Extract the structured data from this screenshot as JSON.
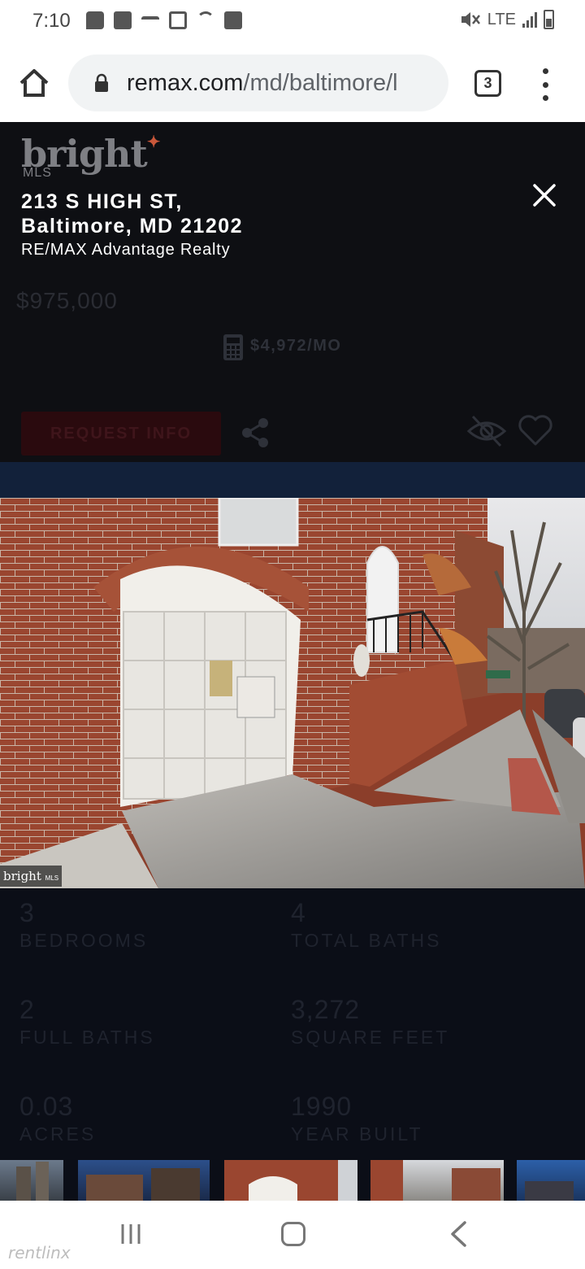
{
  "status_bar": {
    "time": "7:10",
    "network": "LTE",
    "icons": [
      "message-icon",
      "square-icon",
      "missed-call-icon",
      "image-icon",
      "wifi-icon",
      "app-icon",
      "mute-icon",
      "signal-icon",
      "battery-icon"
    ]
  },
  "browser": {
    "url_host": "remax.com",
    "url_path": "/md/baltimore/l",
    "tab_count": "3"
  },
  "listing": {
    "brand": "bright",
    "brand_sub": "MLS",
    "address_line1": "213 S HIGH ST,",
    "address_line2": "Baltimore, MD 21202",
    "agency": "RE/MAX Advantage Realty",
    "price": "$975,000",
    "monthly": "$4,972/MO",
    "request_info_label": "REQUEST INFO",
    "photo_watermark": "bright",
    "photo_watermark_sub": "MLS"
  },
  "facts": [
    {
      "value": "3",
      "label": "BEDROOMS"
    },
    {
      "value": "4",
      "label": "TOTAL BATHS"
    },
    {
      "value": "2",
      "label": "FULL BATHS"
    },
    {
      "value": "3,272",
      "label": "SQUARE FEET"
    },
    {
      "value": "0.03",
      "label": "ACRES"
    },
    {
      "value": "1990",
      "label": "YEAR BUILT"
    }
  ],
  "nav_bar": {
    "watermark": "rentlinx"
  },
  "colors": {
    "overlay_bg": "#0e0f13",
    "brick": "#9a4630",
    "request_btn": "#2a0a0e",
    "accent_star": "#c9573a"
  }
}
